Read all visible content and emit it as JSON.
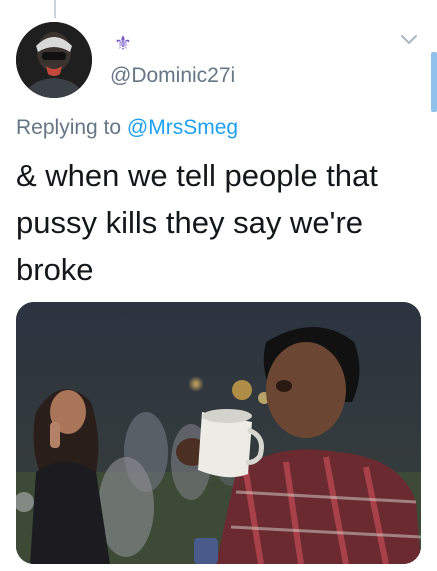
{
  "tweet": {
    "display_name_emoji": "⚜",
    "handle": "@Dominic27i",
    "replying_prefix": "Replying to",
    "replying_to": "@MrsSmeg",
    "text": "& when we tell people that\npussy kills they say we're\nbroke",
    "menu_icon": "chevron-down-icon",
    "media_description_icon": "photo"
  },
  "colors": {
    "link": "#1da1f2",
    "secondary_text": "#657786",
    "primary_text": "#14171a"
  }
}
